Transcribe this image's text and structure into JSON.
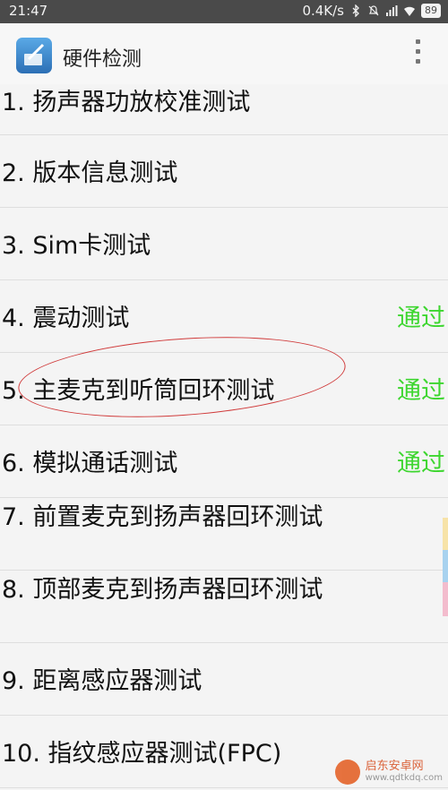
{
  "status_bar": {
    "time": "21:47",
    "speed": "0.4K/s",
    "battery": "89"
  },
  "app_bar": {
    "title": "硬件检测"
  },
  "items": [
    {
      "label": "1. 扬声器功放校准测试",
      "status": ""
    },
    {
      "label": "2. 版本信息测试",
      "status": ""
    },
    {
      "label": "3. Sim卡测试",
      "status": ""
    },
    {
      "label": "4. 震动测试",
      "status": "通过"
    },
    {
      "label": "5. 主麦克到听筒回环测试",
      "status": "通过"
    },
    {
      "label": "6. 模拟通话测试",
      "status": "通过"
    },
    {
      "label": "7. 前置麦克到扬声器回环测试",
      "status": ""
    },
    {
      "label": "8. 顶部麦克到扬声器回环测试",
      "status": ""
    },
    {
      "label": "9. 距离感应器测试",
      "status": ""
    },
    {
      "label": "10. 指纹感应器测试(FPC)",
      "status": ""
    }
  ],
  "watermark": {
    "name": "启东安卓网",
    "url": "www.qdtkdq.com"
  },
  "colors": {
    "pass": "#3dd62f",
    "annotation": "#d03a3a"
  }
}
